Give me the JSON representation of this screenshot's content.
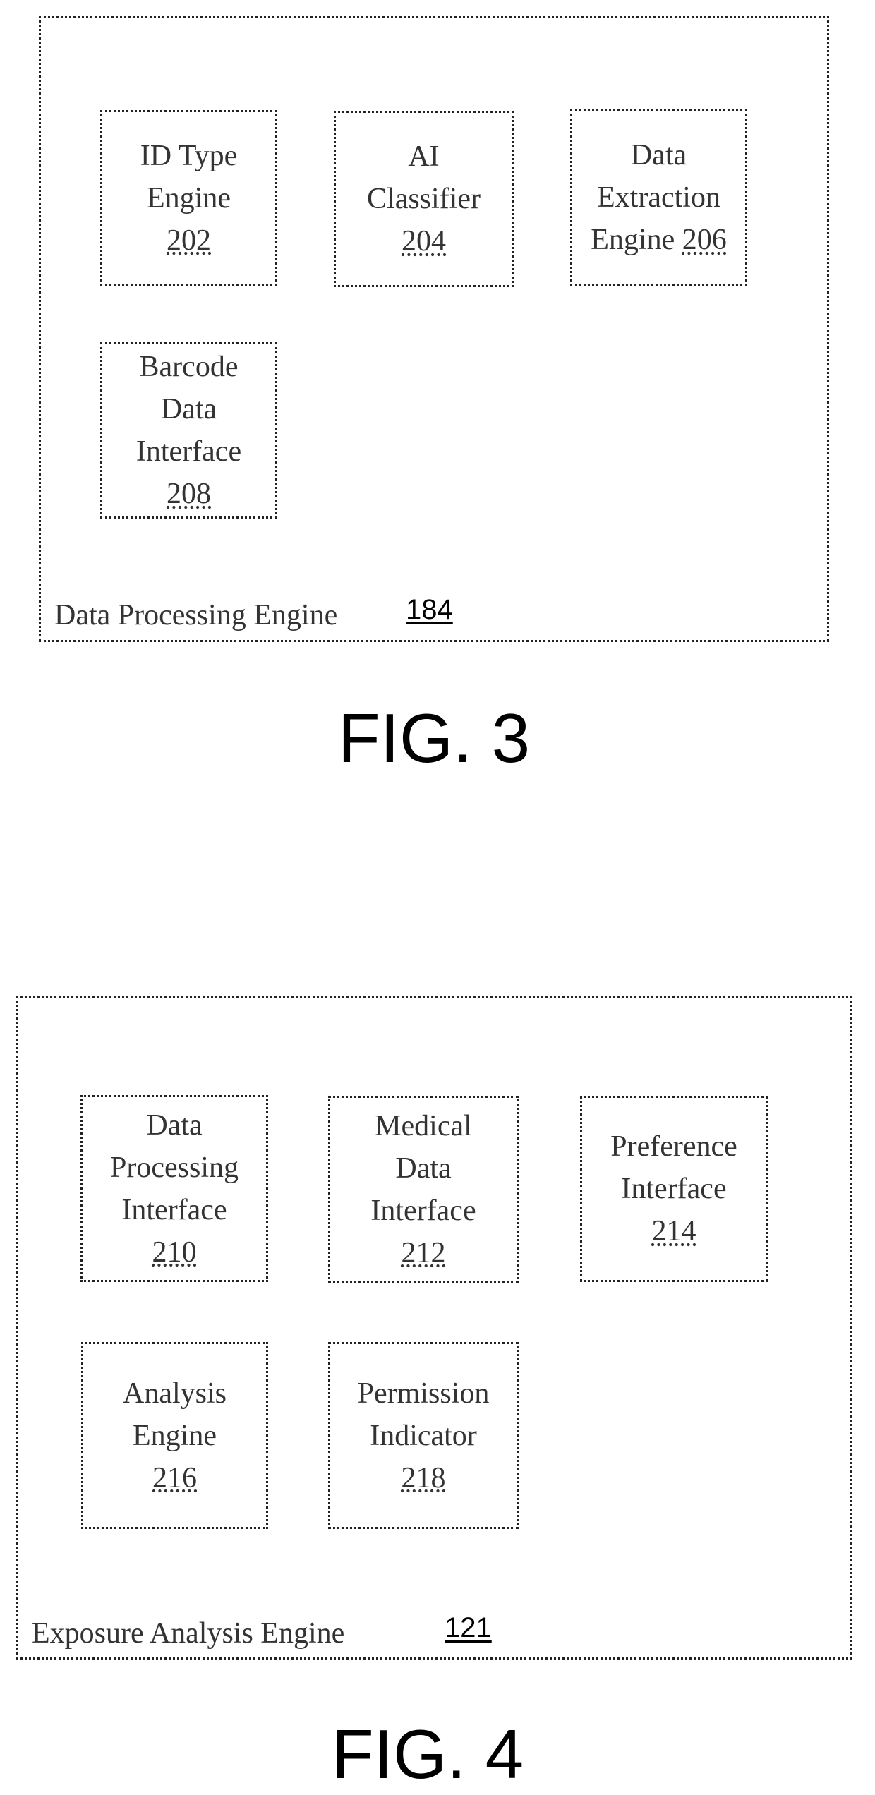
{
  "fig3": {
    "caption": "FIG. 3",
    "container": {
      "label": "Data Processing Engine",
      "ref": "184"
    },
    "components": [
      {
        "lines": [
          "ID Type",
          "Engine"
        ],
        "ref": "202"
      },
      {
        "lines": [
          "AI",
          "Classifier"
        ],
        "ref": "204"
      },
      {
        "lines": [
          "Data",
          "Extraction",
          "Engine"
        ],
        "ref": "206",
        "ref_inline": true
      },
      {
        "lines": [
          "Barcode",
          "Data",
          "Interface"
        ],
        "ref": "208"
      }
    ]
  },
  "fig4": {
    "caption": "FIG. 4",
    "container": {
      "label": "Exposure Analysis Engine",
      "ref": "121"
    },
    "components": [
      {
        "lines": [
          "Data",
          "Processing",
          "Interface"
        ],
        "ref": "210"
      },
      {
        "lines": [
          "Medical",
          "Data",
          "Interface"
        ],
        "ref": "212"
      },
      {
        "lines": [
          "Preference",
          "Interface"
        ],
        "ref": "214"
      },
      {
        "lines": [
          "Analysis",
          "Engine"
        ],
        "ref": "216"
      },
      {
        "lines": [
          "Permission",
          "Indicator"
        ],
        "ref": "218"
      }
    ]
  }
}
